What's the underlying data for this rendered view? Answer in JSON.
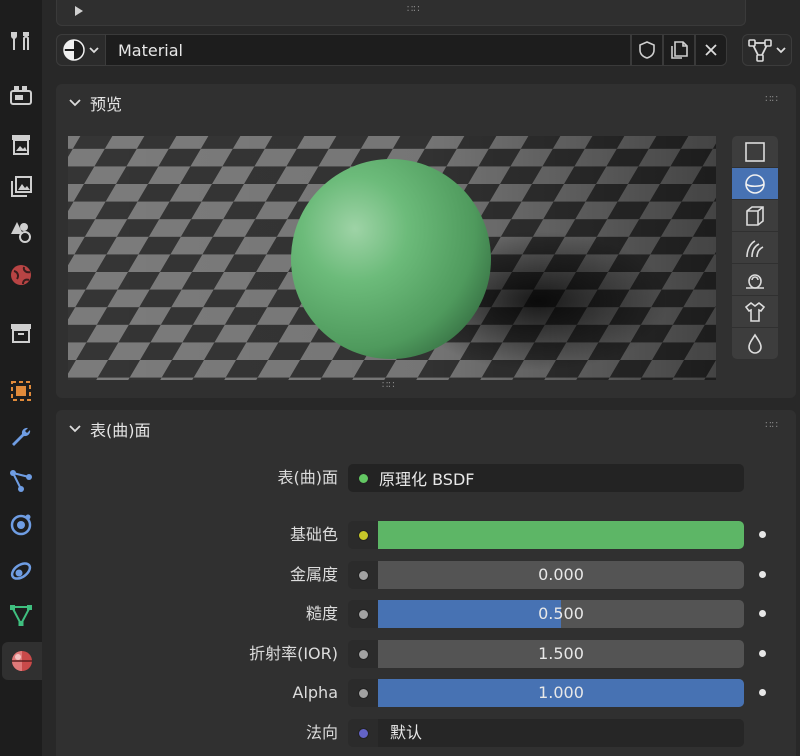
{
  "sidebar": {
    "tabs": [
      {
        "name": "tool-icon"
      },
      {
        "name": "render-icon"
      },
      {
        "name": "output-icon"
      },
      {
        "name": "view-layer-icon"
      },
      {
        "name": "scene-icon"
      },
      {
        "name": "world-icon"
      },
      {
        "name": "collection-icon"
      },
      {
        "name": "object-icon"
      },
      {
        "name": "modifier-icon"
      },
      {
        "name": "particles-icon"
      },
      {
        "name": "physics-icon"
      },
      {
        "name": "constraints-icon"
      },
      {
        "name": "data-icon"
      },
      {
        "name": "material-icon"
      }
    ],
    "active_tab": "material-icon"
  },
  "material_selector": {
    "name": "Material",
    "browse_icon": "material-sphere-icon",
    "fake_user_icon": "shield-icon",
    "duplicate_icon": "duplicate-icon",
    "unlink_icon": "close-icon",
    "node_tree_icon": "node-tree-icon"
  },
  "preview": {
    "title": "预览",
    "shapes": [
      {
        "name": "plane-preview-icon",
        "active": false
      },
      {
        "name": "sphere-preview-icon",
        "active": true
      },
      {
        "name": "cube-preview-icon",
        "active": false
      },
      {
        "name": "hair-preview-icon",
        "active": false
      },
      {
        "name": "monkey-preview-icon",
        "active": false
      },
      {
        "name": "cloth-preview-icon",
        "active": false
      },
      {
        "name": "fluid-preview-icon",
        "active": false
      }
    ],
    "sphere_color": "#5fae6e"
  },
  "surface": {
    "title": "表(曲)面",
    "shader_label": "表(曲)面",
    "shader_value": "原理化 BSDF",
    "shader_socket_color": "#63c763",
    "properties": [
      {
        "label": "基础色",
        "type": "color",
        "value": "",
        "color": "#5db666",
        "socket_color": "#c7c729"
      },
      {
        "label": "金属度",
        "type": "float",
        "value": "0.000",
        "fraction": 0.0,
        "socket_color": "#a1a1a1"
      },
      {
        "label": "糙度",
        "type": "float",
        "value": "0.500",
        "fraction": 0.5,
        "socket_color": "#a1a1a1"
      },
      {
        "label": "折射率(IOR)",
        "type": "float",
        "value": "1.500",
        "fraction": 0.0,
        "socket_color": "#a1a1a1"
      },
      {
        "label": "Alpha",
        "type": "float",
        "value": "1.000",
        "fraction": 1.0,
        "socket_color": "#a1a1a1"
      },
      {
        "label": "法向",
        "type": "vector",
        "value": "默认",
        "socket_color": "#6363c7"
      }
    ]
  }
}
